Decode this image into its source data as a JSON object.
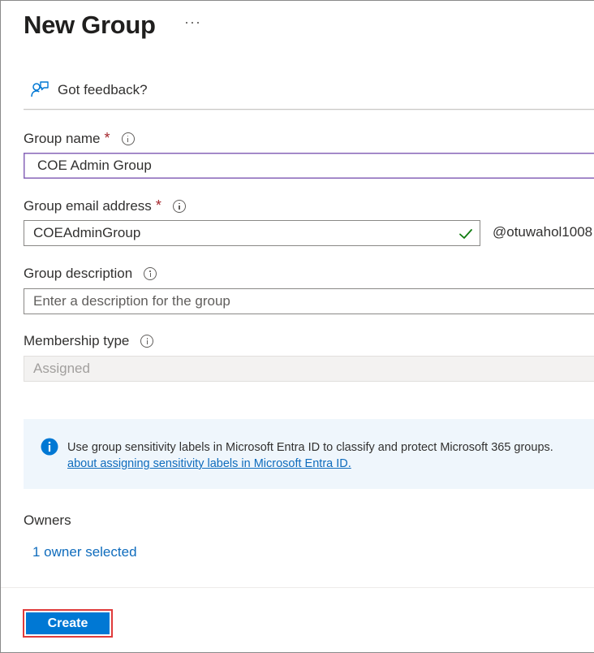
{
  "page": {
    "title": "New Group",
    "more_label": "···"
  },
  "feedback": {
    "label": "Got feedback?",
    "icon": "feedback-person-icon"
  },
  "form": {
    "group_name": {
      "label": "Group name",
      "required_marker": "*",
      "value": "COE Admin Group"
    },
    "group_email": {
      "label": "Group email address",
      "required_marker": "*",
      "value": "COEAdminGroup",
      "domain_suffix": "@otuwahol1008",
      "valid": true
    },
    "group_description": {
      "label": "Group description",
      "placeholder": "Enter a description for the group"
    },
    "membership_type": {
      "label": "Membership type",
      "value": "Assigned",
      "disabled": true
    }
  },
  "info_bar": {
    "text": "Use group sensitivity labels in Microsoft Entra ID to classify and protect Microsoft 365 groups.",
    "link_text": "about assigning sensitivity labels in Microsoft Entra ID."
  },
  "owners": {
    "label": "Owners",
    "link_text": "1 owner selected"
  },
  "footer": {
    "create_label": "Create"
  },
  "colors": {
    "accent": "#0078d4",
    "link": "#0f6cbd",
    "required": "#a4262c",
    "focus_border": "#8764b8",
    "valid_check": "#107c10",
    "info_bar_bg": "#eff6fc",
    "highlight_outline": "#e03b3b"
  }
}
